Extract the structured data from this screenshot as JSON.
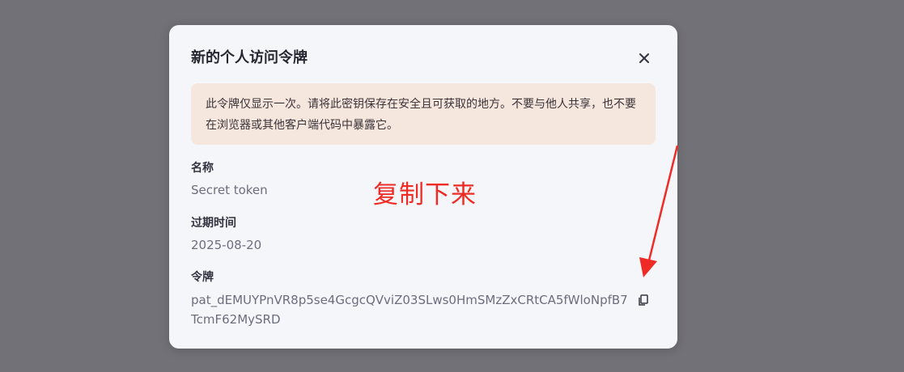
{
  "dialog": {
    "title": "新的个人访问令牌",
    "close_icon": "close-icon",
    "warning": "此令牌仅显示一次。请将此密钥保存在安全且可获取的地方。不要与他人共享，也不要在浏览器或其他客户端代码中暴露它。",
    "name_label": "名称",
    "name_value": "Secret token",
    "expiry_label": "过期时间",
    "expiry_value": "2025-08-20",
    "token_label": "令牌",
    "token_value": "pat_dEMUYPnVR8p5se4GcgcQVviZ03SLws0HmSMzZxCRtCA5fWloNpfB7TcmF62MySRD",
    "copy_icon": "copy-icon"
  },
  "annotation": {
    "text": "复制下来",
    "color": "#ee2b24"
  },
  "colors": {
    "backdrop": "#727177",
    "modal_bg": "#f5f6fa",
    "warning_bg": "#f5e7de"
  }
}
